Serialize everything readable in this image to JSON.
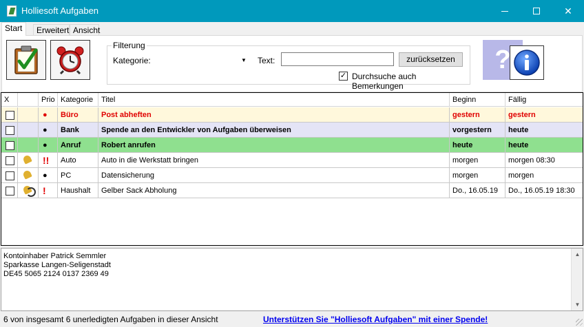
{
  "window": {
    "title": "Holliesoft Aufgaben",
    "controls": {
      "minimize": "",
      "maximize": "",
      "close": "✕"
    }
  },
  "tabs": [
    {
      "label": "Start",
      "active": true
    },
    {
      "label": "Erweitert",
      "active": false
    },
    {
      "label": "Ansicht",
      "active": false
    }
  ],
  "toolbar": {
    "buttons": [
      {
        "icon": "clipboard-check-icon"
      },
      {
        "icon": "alarm-clock-icon"
      },
      {
        "icon": "help-icon",
        "glyph": "?"
      },
      {
        "icon": "info-icon",
        "glyph": "i"
      }
    ],
    "filter": {
      "legend": "Filterung",
      "kategorie_label": "Kategorie:",
      "kategorie_value": "",
      "text_label": "Text:",
      "text_value": "",
      "reset_label": "zurücksetzen",
      "search_notes_label": "Durchsuche auch Bemerkungen",
      "search_notes_checked": true
    }
  },
  "grid": {
    "columns": [
      "X",
      "",
      "Prio",
      "Kategorie",
      "Titel",
      "Beginn",
      "Fällig"
    ],
    "rows": [
      {
        "done": false,
        "alarm": "",
        "prio": "●",
        "kategorie": "Büro",
        "titel": "Post abheften",
        "beginn": "gestern",
        "faellig": "gestern",
        "bg": "#fff8dc",
        "bold": true,
        "red": true
      },
      {
        "done": false,
        "alarm": "",
        "prio": "●",
        "kategorie": "Bank",
        "titel": "Spende an den Entwickler von Aufgaben überweisen",
        "beginn": "vorgestern",
        "faellig": "heute",
        "bg": "#e4e4f6",
        "bold": true,
        "red": false
      },
      {
        "done": false,
        "alarm": "",
        "prio": "●",
        "kategorie": "Anruf",
        "titel": "Robert anrufen",
        "beginn": "heute",
        "faellig": "heute",
        "bg": "#8fe08f",
        "bold": true,
        "red": false
      },
      {
        "done": false,
        "alarm": "bell-icon",
        "prio": "!!",
        "kategorie": "Auto",
        "titel": "Auto in die Werkstatt bringen",
        "beginn": "morgen",
        "faellig": "morgen 08:30",
        "bg": "#ffffff",
        "bold": false,
        "red": false
      },
      {
        "done": false,
        "alarm": "bell-icon",
        "prio": "●",
        "kategorie": "PC",
        "titel": "Datensicherung",
        "beginn": "morgen",
        "faellig": "morgen",
        "bg": "#ffffff",
        "bold": false,
        "red": false
      },
      {
        "done": false,
        "alarm": "bell-ring-icon",
        "prio": "!",
        "kategorie": "Haushalt",
        "titel": "Gelber Sack Abholung",
        "beginn": "Do., 16.05.19",
        "faellig": "Do., 16.05.19 18:30",
        "bg": "#ffffff",
        "bold": false,
        "red": false
      }
    ],
    "prio_colors": {
      "●": "#000000",
      "!!": "#e00000",
      "!": "#e00000"
    },
    "first_row_prio_color": "#e00000"
  },
  "notes": {
    "text": "Kontoinhaber Patrick Semmler\nSparkasse Langen-Seligenstadt\nDE45 5065 2124 0137 2369 49"
  },
  "status": {
    "text": "6 von insgesamt 6 unerledigten Aufgaben in dieser Ansicht",
    "link": "Unterstützen Sie \"Holliesoft Aufgaben\" mit einer Spende!"
  },
  "colors": {
    "titlebar": "#0099bc",
    "help_button": "#b8b8e8",
    "link": "#0000ee",
    "overdue": "#e00000"
  }
}
